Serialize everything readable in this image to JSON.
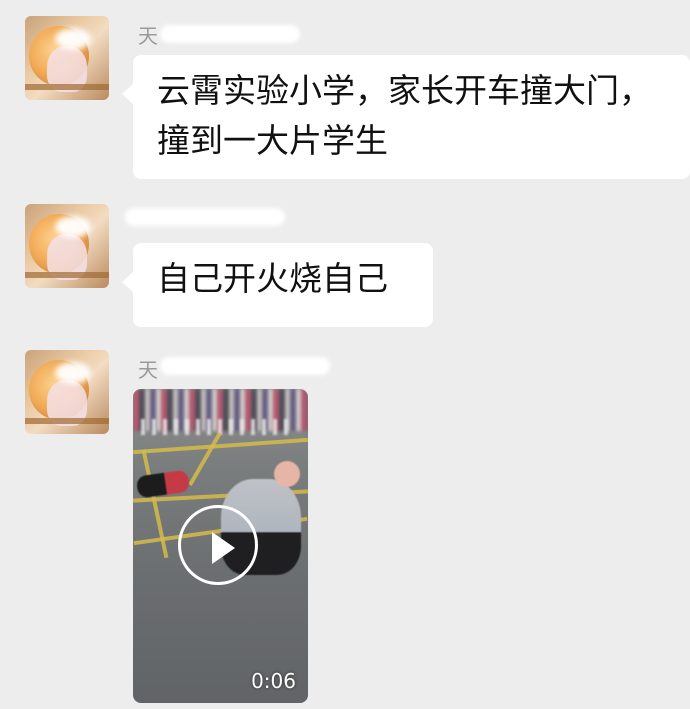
{
  "chat": {
    "messages": [
      {
        "sender": "天",
        "text_line1": "云霄实验小学，家长开车撞大门，",
        "text_line2": "撞到一大片学生"
      },
      {
        "sender": "",
        "text_line1": "自己开火烧自己"
      },
      {
        "sender": "天",
        "video": {
          "duration": "0:06",
          "play_icon": "play-icon"
        }
      }
    ]
  },
  "colors": {
    "background": "#ededed",
    "bubble": "#ffffff",
    "text": "#111111",
    "sender_text": "#9a9a9a"
  }
}
